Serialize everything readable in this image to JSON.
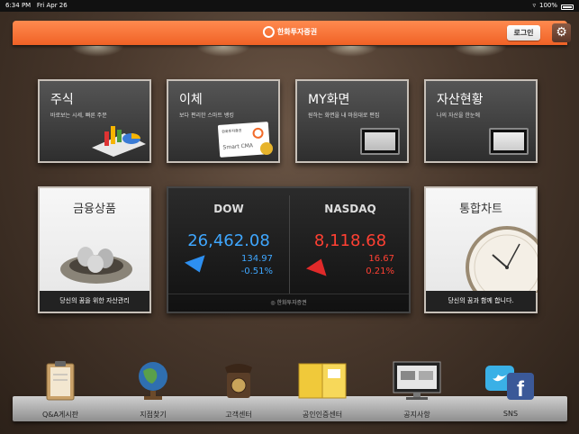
{
  "status_bar": {
    "time": "6:34 PM",
    "date": "Fri Apr 26",
    "battery": "100%"
  },
  "header": {
    "brand": "한화투자증권",
    "login_label": "로그인"
  },
  "tiles": {
    "stock": {
      "title": "주식",
      "subtitle": "바로보는 시세, 빠른 주문"
    },
    "transfer": {
      "title": "이체",
      "subtitle": "보다 편리한 스마트 뱅킹",
      "card_brand": "한화투자증권",
      "card_text": "Smart CMA"
    },
    "my_screen": {
      "title": "MY화면",
      "subtitle": "원하는 화면을 내 마음대로 편집"
    },
    "assets": {
      "title": "자산현황",
      "subtitle": "나의 자산을 한눈에"
    },
    "finance": {
      "title": "금융상품",
      "caption": "당신의 꿈을 위한 자산관리"
    },
    "chart": {
      "title": "통합차트",
      "caption": "당신의 꿈과 함께 합니다."
    }
  },
  "markets": {
    "dow": {
      "name": "DOW",
      "value": "26,462.08",
      "change": "134.97",
      "percent": "-0.51%",
      "direction": "down"
    },
    "nasdaq": {
      "name": "NASDAQ",
      "value": "8,118.68",
      "change": "16.67",
      "percent": "0.21%",
      "direction": "up"
    },
    "footer": "한화투자증권"
  },
  "dock": [
    {
      "label": "Q&A게시판",
      "icon": "clipboard-icon"
    },
    {
      "label": "지점찾기",
      "icon": "globe-icon"
    },
    {
      "label": "고객센터",
      "icon": "telephone-icon"
    },
    {
      "label": "공인인증센터",
      "icon": "folder-icon"
    },
    {
      "label": "공지사항",
      "icon": "monitor-icon"
    },
    {
      "label": "SNS",
      "icon": "social-icon"
    }
  ],
  "colors": {
    "header": "#f06226",
    "down": "#3fa7ff",
    "up": "#ff4033"
  }
}
